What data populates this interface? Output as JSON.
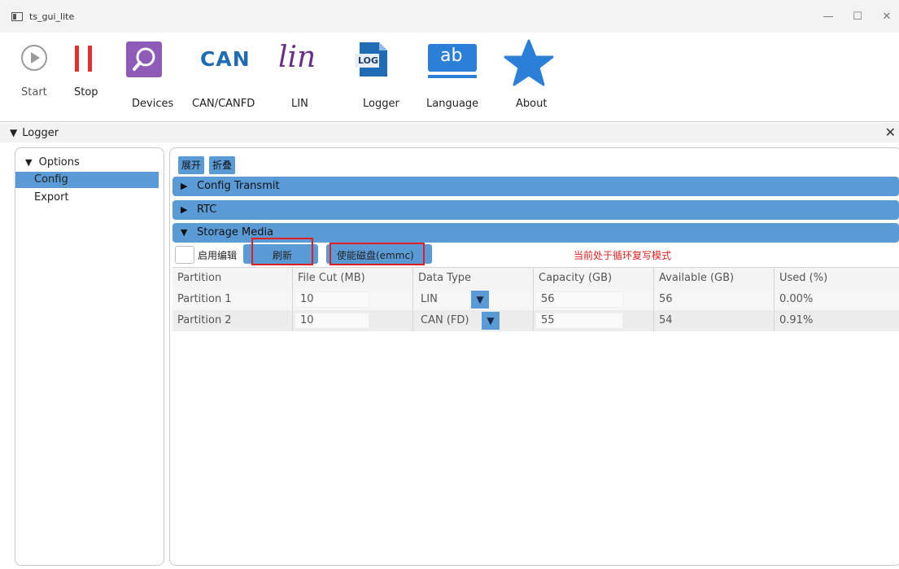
{
  "window": {
    "title": "ts_gui_lite",
    "minimize": "—",
    "maximize": "☐",
    "close": "✕"
  },
  "toolbar": {
    "start": "Start",
    "stop": "Stop",
    "devices": "Devices",
    "can": "CAN/CANFD",
    "can_logo": "CAN",
    "lin": "LIN",
    "lin_logo": "lin",
    "logger": "Logger",
    "logger_logo": "LOG",
    "language": "Language",
    "language_logo": "ab",
    "about": "About"
  },
  "panel": {
    "title": "Logger",
    "arrow": "▼",
    "close": "✕"
  },
  "tree": {
    "root_arrow": "▼",
    "root": "Options",
    "items": [
      {
        "label": "Config",
        "selected": true
      },
      {
        "label": "Export",
        "selected": false
      }
    ]
  },
  "actions": {
    "expand": "展开",
    "collapse": "折叠"
  },
  "sections": [
    {
      "arrow": "▶",
      "title": "Config Transmit"
    },
    {
      "arrow": "▶",
      "title": "RTC"
    },
    {
      "arrow": "▼",
      "title": "Storage Media"
    }
  ],
  "storage": {
    "enable_edit": "启用编辑",
    "refresh": "刷新",
    "enable_disk": "使能磁盘(emmc)",
    "status": "当前处于循环复写模式",
    "status_color": "#e02020",
    "highlight_color": "#e02020"
  },
  "table": {
    "headers": [
      "Partition",
      "File Cut (MB)",
      "Data Type",
      "Capacity (GB)",
      "Available (GB)",
      "Used (%)"
    ],
    "rows": [
      {
        "partition": "Partition 1",
        "file_cut": "10",
        "data_type": "LIN",
        "capacity": "56",
        "available": "56",
        "used": "0.00%"
      },
      {
        "partition": "Partition 2",
        "file_cut": "10",
        "data_type": "CAN (FD)",
        "capacity": "55",
        "available": "54",
        "used": "0.91%"
      }
    ],
    "dropdown_glyph": "▼"
  },
  "colors": {
    "accent": "#5b9bd5",
    "can_blue": "#1f6cb4",
    "lin_purple": "#6b2b8c",
    "devices_purple": "#8e5bb8",
    "about_blue": "#2b7fd6"
  }
}
